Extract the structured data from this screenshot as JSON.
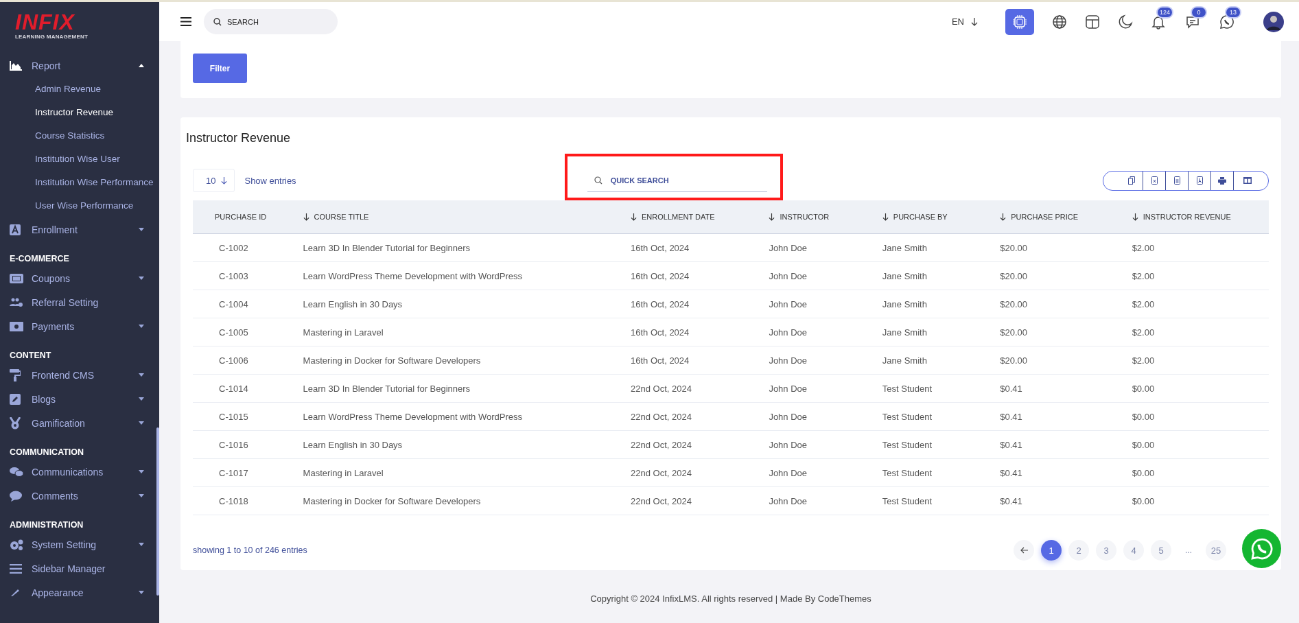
{
  "sidebar": {
    "logo": {
      "title": "INFIX",
      "subtitle": "LEARNING MANAGEMENT"
    },
    "sections": [
      {
        "items": [
          {
            "label": "Report",
            "kind": "group",
            "expanded": true,
            "children": [
              {
                "label": "Admin Revenue",
                "selected": false
              },
              {
                "label": "Instructor Revenue",
                "selected": true
              },
              {
                "label": "Course Statistics",
                "selected": false
              },
              {
                "label": "Institution Wise User",
                "selected": false
              },
              {
                "label": "Institution Wise Performance",
                "selected": false
              },
              {
                "label": "User Wise Performance",
                "selected": false
              }
            ]
          },
          {
            "label": "Enrollment",
            "kind": "group",
            "expanded": false
          }
        ]
      },
      {
        "heading": "E-COMMERCE",
        "items": [
          {
            "label": "Coupons",
            "kind": "group",
            "expanded": false
          },
          {
            "label": "Referral Setting",
            "kind": "link"
          },
          {
            "label": "Payments",
            "kind": "group",
            "expanded": false
          }
        ]
      },
      {
        "heading": "CONTENT",
        "items": [
          {
            "label": "Frontend CMS",
            "kind": "group",
            "expanded": false
          },
          {
            "label": "Blogs",
            "kind": "group",
            "expanded": false
          },
          {
            "label": "Gamification",
            "kind": "group",
            "expanded": false
          }
        ]
      },
      {
        "heading": "COMMUNICATION",
        "items": [
          {
            "label": "Communications",
            "kind": "group",
            "expanded": false
          },
          {
            "label": "Comments",
            "kind": "group",
            "expanded": false
          }
        ]
      },
      {
        "heading": "ADMINISTRATION",
        "items": [
          {
            "label": "System Setting",
            "kind": "group",
            "expanded": false
          },
          {
            "label": "Sidebar Manager",
            "kind": "link"
          },
          {
            "label": "Appearance",
            "kind": "group",
            "expanded": false
          }
        ]
      }
    ]
  },
  "header": {
    "search": {
      "placeholder": "SEARCH"
    },
    "language": "EN",
    "badges": [
      "124",
      "0",
      "13"
    ]
  },
  "filter": {
    "button": "Filter"
  },
  "report": {
    "title": "Instructor Revenue",
    "page_size": "10",
    "show_entries": "Show entries",
    "quick_search": {
      "placeholder": "QUICK SEARCH",
      "highlighted": true
    },
    "columns": [
      {
        "label": "PURCHASE ID",
        "sortable": false
      },
      {
        "label": "COURSE TITLE",
        "sortable": true
      },
      {
        "label": "ENROLLMENT DATE",
        "sortable": true
      },
      {
        "label": "INSTRUCTOR",
        "sortable": true
      },
      {
        "label": "PURCHASE BY",
        "sortable": true
      },
      {
        "label": "PURCHASE PRICE",
        "sortable": true
      },
      {
        "label": "INSTRUCTOR REVENUE",
        "sortable": true
      }
    ],
    "rows": [
      [
        "C-1002",
        "Learn 3D In Blender Tutorial for Beginners",
        "16th Oct, 2024",
        "John Doe",
        "Jane Smith",
        "$20.00",
        "$2.00"
      ],
      [
        "C-1003",
        "Learn WordPress Theme Development with WordPress",
        "16th Oct, 2024",
        "John Doe",
        "Jane Smith",
        "$20.00",
        "$2.00"
      ],
      [
        "C-1004",
        "Learn English in 30 Days",
        "16th Oct, 2024",
        "John Doe",
        "Jane Smith",
        "$20.00",
        "$2.00"
      ],
      [
        "C-1005",
        "Mastering in Laravel",
        "16th Oct, 2024",
        "John Doe",
        "Jane Smith",
        "$20.00",
        "$2.00"
      ],
      [
        "C-1006",
        "Mastering in Docker for Software Developers",
        "16th Oct, 2024",
        "John Doe",
        "Jane Smith",
        "$20.00",
        "$2.00"
      ],
      [
        "C-1014",
        "Learn 3D In Blender Tutorial for Beginners",
        "22nd Oct, 2024",
        "John Doe",
        "Test Student",
        "$0.41",
        "$0.00"
      ],
      [
        "C-1015",
        "Learn WordPress Theme Development with WordPress",
        "22nd Oct, 2024",
        "John Doe",
        "Test Student",
        "$0.41",
        "$0.00"
      ],
      [
        "C-1016",
        "Learn English in 30 Days",
        "22nd Oct, 2024",
        "John Doe",
        "Test Student",
        "$0.41",
        "$0.00"
      ],
      [
        "C-1017",
        "Mastering in Laravel",
        "22nd Oct, 2024",
        "John Doe",
        "Test Student",
        "$0.41",
        "$0.00"
      ],
      [
        "C-1018",
        "Mastering in Docker for Software Developers",
        "22nd Oct, 2024",
        "John Doe",
        "Test Student",
        "$0.41",
        "$0.00"
      ]
    ],
    "showing": "showing 1 to 10 of 246 entries",
    "pages": [
      {
        "kind": "page",
        "label": "1",
        "selected": true
      },
      {
        "kind": "page",
        "label": "2",
        "selected": false
      },
      {
        "kind": "page",
        "label": "3",
        "selected": false
      },
      {
        "kind": "page",
        "label": "4",
        "selected": false
      },
      {
        "kind": "page",
        "label": "5",
        "selected": false
      },
      {
        "kind": "ellipsis",
        "label": "..."
      },
      {
        "kind": "page",
        "label": "25",
        "selected": false
      }
    ]
  },
  "footer": "Copyright © 2024 InfixLMS. All rights reserved | Made By CodeThemes"
}
